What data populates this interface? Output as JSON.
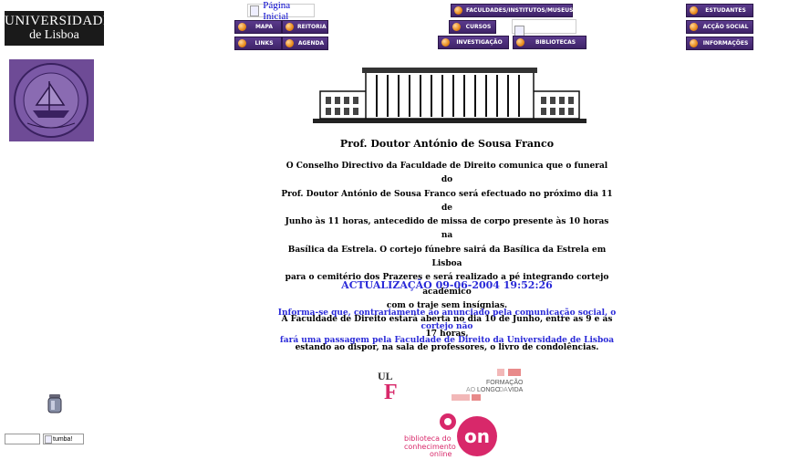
{
  "header": {
    "logo": {
      "line1": "Universidade",
      "line2": "de Lisboa"
    },
    "home_link": "Página Inicial"
  },
  "nav": {
    "left": [
      {
        "key": "mapa",
        "label": "MAPA"
      },
      {
        "key": "reitoria",
        "label": "REITORIA"
      },
      {
        "key": "links",
        "label": "LINKS"
      },
      {
        "key": "agenda",
        "label": "AGENDA"
      }
    ],
    "center": [
      {
        "key": "faculdades",
        "label": "FACULDADES/INSTITUTOS/MUSEUS"
      },
      {
        "key": "cursos",
        "label": "CURSOS"
      },
      {
        "key": "investigacao",
        "label": "INVESTIGAÇÃO"
      },
      {
        "key": "bibliotecas",
        "label": "BIBLIOTECAS"
      }
    ],
    "right": [
      {
        "key": "estudantes",
        "label": "ESTUDANTES"
      },
      {
        "key": "accao_social",
        "label": "ACÇÃO SOCIAL"
      },
      {
        "key": "informacoes",
        "label": "INFORMAÇÕES"
      }
    ]
  },
  "main": {
    "title": "Prof. Doutor António de Sousa Franco",
    "announcement": [
      "O Conselho Directivo da Faculdade de Direito comunica que o funeral do",
      "Prof. Doutor António de Sousa Franco será efectuado no próximo dia 11 de",
      "Junho às 11 horas, antecedido de missa de corpo presente às 10 horas na",
      "Basílica da Estrela. O cortejo fúnebre sairá da Basílica da Estrela em Lisboa",
      "para o cemitério dos Prazeres e será realizado a pé integrando cortejo académico",
      "com o traje sem insígnias.",
      "A Faculdade de Direito estará aberta no dia 10 de Junho, entre as 9 e as 17 horas,",
      "estando ao dispor, na sala de professores, o livro de condolências."
    ],
    "update": "ACTUALIZAÇÃO 09-06-2004 19:52:26",
    "notice": [
      "Informa-se que, contrariamente ao anunciado pela comunicação social, o cortejo não",
      "fará uma passagem pela Faculdade de Direito da Universidade de Lisboa"
    ]
  },
  "footer": {
    "ulf_logo": "ULF",
    "formacao": {
      "line1": "FORMAÇÃO",
      "line2": "AOLONGODAVIDA"
    },
    "bol": {
      "line1": "biblioteca do",
      "line2": "conhecimento",
      "line3": "online",
      "mark": "on"
    },
    "tumba_alt": "tumba!"
  },
  "colors": {
    "button": "#4b2d7a",
    "link": "#2a2ad8",
    "accent_pink": "#d8286a"
  }
}
